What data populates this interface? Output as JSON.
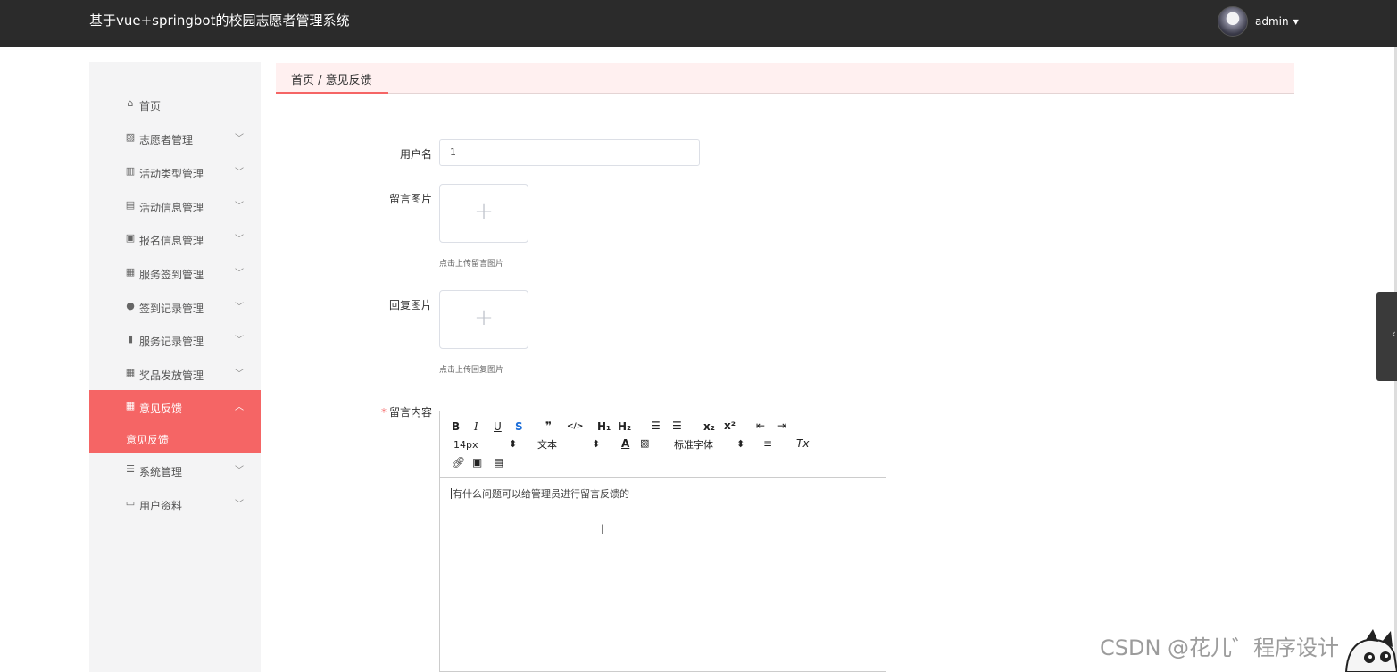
{
  "header": {
    "title": "基于vue+springbot的校园志愿者管理系统",
    "username": "admin"
  },
  "sidebar": {
    "items": [
      {
        "label": "首页",
        "icon": "home-icon"
      },
      {
        "label": "志愿者管理",
        "icon": "chart-icon"
      },
      {
        "label": "活动类型管理",
        "icon": "books-icon"
      },
      {
        "label": "活动信息管理",
        "icon": "clipboard-icon"
      },
      {
        "label": "报名信息管理",
        "icon": "clipboard-check-icon"
      },
      {
        "label": "服务签到管理",
        "icon": "grid-icon"
      },
      {
        "label": "签到记录管理",
        "icon": "user-icon"
      },
      {
        "label": "服务记录管理",
        "icon": "bar-chart-icon"
      },
      {
        "label": "奖品发放管理",
        "icon": "grid-icon"
      },
      {
        "label": "意见反馈",
        "icon": "grid-icon"
      },
      {
        "label": "系统管理",
        "icon": "list-icon"
      },
      {
        "label": "用户资料",
        "icon": "card-icon"
      }
    ],
    "active_submenu": "意见反馈"
  },
  "breadcrumb": "首页 / 意见反馈",
  "form": {
    "username_label": "用户名",
    "username_value": "1",
    "image_label": "留言图片",
    "image_hint": "点击上传留言图片",
    "reply_image_label": "回复图片",
    "reply_image_hint": "点击上传回复图片",
    "content_label": "留言内容",
    "content_value": "有什么问题可以给管理员进行留言反馈的"
  },
  "editor_toolbar": {
    "bold": "B",
    "italic": "I",
    "underline": "U",
    "strike": "S",
    "blockquote": "❞",
    "code": "</>",
    "h1": "H₁",
    "h2": "H₂",
    "ordered_list": "☰",
    "bullet_list": "☰",
    "subscript": "x₂",
    "superscript": "x²",
    "outdent": "⇤",
    "indent": "⇥",
    "font_size": "14px",
    "paragraph": "文本",
    "font_family": "标准字体",
    "align": "≡",
    "clear_format": "Tx"
  },
  "watermark": "CSDN @花儿゛程序设计"
}
